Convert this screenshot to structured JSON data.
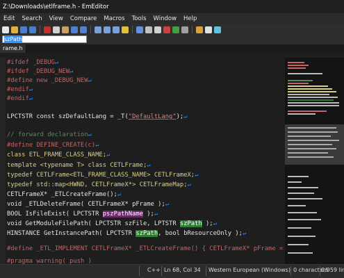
{
  "window": {
    "title": "Z:\\Downloads\\etlframe.h - EmEditor"
  },
  "menu": [
    "Edit",
    "Search",
    "View",
    "Compare",
    "Macros",
    "Tools",
    "Window",
    "Help"
  ],
  "find": {
    "value": "szPath"
  },
  "tab": {
    "label": "rame.h"
  },
  "code": {
    "l1_a": "#ifdef _DEBUG",
    "l2_a": "#ifdef _DEBUG_NEW",
    "l3_a": "#define new _DEBUG_NEW",
    "l4_a": "#endif",
    "l5_a": "#endif",
    "l6_a": "LPCTSTR const szDefaultLang = _T(",
    "l6_b": "\"DefaultLang\"",
    "l6_c": ");",
    "l7_a": "// forward declaration",
    "l8_a": "#define DEFINE_CREATE(c)",
    "l9_a": "class ETL_FRAME_CLASS_NAME;",
    "l10_a": "template <typename T> class CETLFrame;",
    "l11_a": "typedef CETLFrame<ETL_FRAME_CLASS_NAME> CETLFrameX;",
    "l12_a": "typedef std::map<HWND, CETLFrameX*> CETLFrameMap;",
    "l13_a": "CETLFrameX* _ETLCreateFrame();",
    "l14_a": "void _ETLDeleteFrame( CETLFrameX* pFrame );",
    "l15_a": "BOOL IsFileExist( LPCTSTR ",
    "l15_b": "pszPathName",
    "l15_c": " );",
    "l16_a": "void GetModuleFilePath( LPCTSTR szFile, LPTSTR ",
    "l16_b": "szPath",
    "l16_c": " );",
    "l17_a": "HINSTANCE GetInstancePath( LPCTSTR ",
    "l17_b": "szPath",
    "l17_c": ", bool bResourceOnly );",
    "l18_a": "#define _ETL_IMPLEMENT CETLFrameX* _ETLCreateFrame() { CETLFrameX* pFrame = new",
    "l19_a": "#pragma warning( push )"
  },
  "status": {
    "lang": "C++",
    "pos": "Ln 68, Col 34",
    "encoding": "Western European (Windows)",
    "chars": "0 characters",
    "lines": "0/959 lin"
  },
  "colors": {
    "bg": "#1e1e1e",
    "preproc": "#c86464",
    "keyword": "#dcd082",
    "comment": "#5c8a5c",
    "highlight_purple": "#6a2a6a",
    "highlight_green": "#2e7d32"
  }
}
